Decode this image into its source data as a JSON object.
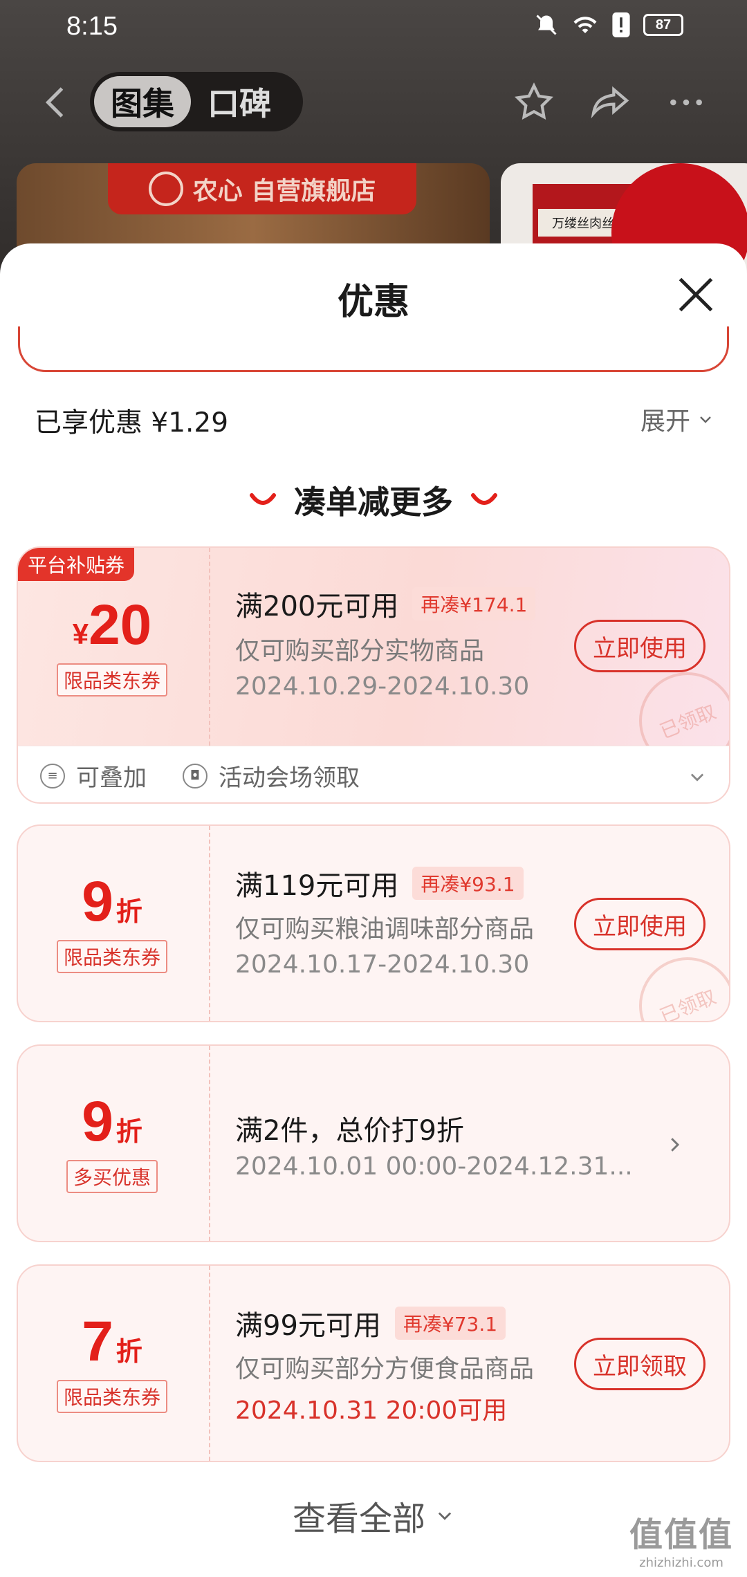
{
  "status_bar": {
    "time": "8:15",
    "battery": "87"
  },
  "top_nav": {
    "seg_tabs": [
      "图集",
      "口碑"
    ]
  },
  "banner": {
    "store_tag": "农心 自营旗舰店",
    "product_label": "万缕丝肉丝"
  },
  "sheet": {
    "title": "优惠",
    "enjoyed": "已享优惠 ¥1.29",
    "expand": "展开",
    "section_title": "凑单减更多",
    "view_all": "查看全部"
  },
  "coupons": [
    {
      "ribbon": "平台补贴券",
      "currency": "¥",
      "amount": "20",
      "type": "限品类东券",
      "condition": "满200元可用",
      "pill": "再凑¥174.1",
      "desc": "仅可购买部分实物商品",
      "date": "2024.10.29-2024.10.30",
      "button": "立即使用",
      "stamp": "已领取",
      "footer": {
        "stackable": "可叠加",
        "venue": "活动会场领取"
      }
    },
    {
      "amount": "9",
      "unit": "折",
      "type": "限品类东券",
      "condition": "满119元可用",
      "pill": "再凑¥93.1",
      "desc": "仅可购买粮油调味部分商品",
      "date": "2024.10.17-2024.10.30",
      "button": "立即使用",
      "stamp": "已领取"
    },
    {
      "amount": "9",
      "unit": "折",
      "type": "多买优惠",
      "condition": "满2件，总价打9折",
      "date": "2024.10.01 00:00-2024.12.31..."
    },
    {
      "amount": "7",
      "unit": "折",
      "type": "限品类东券",
      "condition": "满99元可用",
      "pill": "再凑¥73.1",
      "desc": "仅可购买部分方便食品商品",
      "date": "2024.10.31 20:00可用",
      "button": "立即领取"
    }
  ],
  "watermark": {
    "logo": "值值值",
    "url": "zhizhizhi.com"
  },
  "colors": {
    "accent": "#e3201a",
    "coupon_bg": "#fef4f3",
    "pill_bg": "#fcdcd8"
  }
}
